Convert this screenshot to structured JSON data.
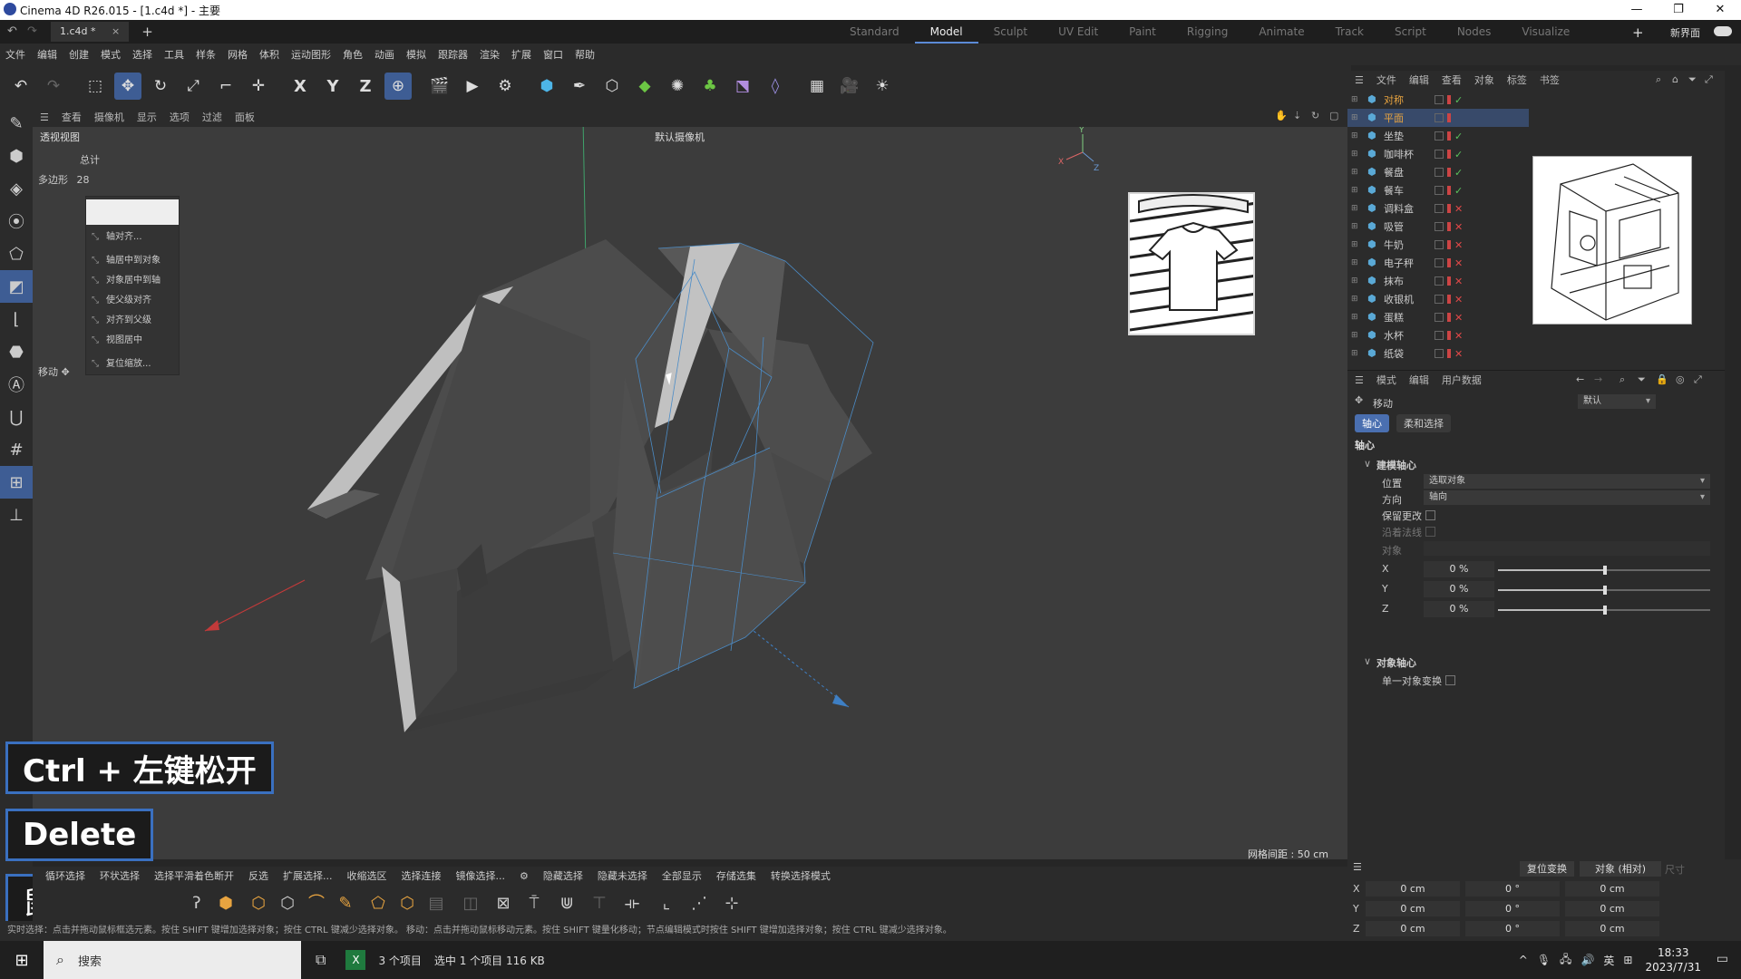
{
  "window": {
    "title": "Cinema 4D R26.015 - [1.c4d *] - 主要",
    "doc_tab": "1.c4d *"
  },
  "layouts": [
    "Standard",
    "Model",
    "Sculpt",
    "UV Edit",
    "Paint",
    "Rigging",
    "Animate",
    "Track",
    "Script",
    "Nodes",
    "Visualize"
  ],
  "active_layout": "Model",
  "new_interface": "新界面",
  "menu": [
    "文件",
    "编辑",
    "创建",
    "模式",
    "选择",
    "工具",
    "样条",
    "网格",
    "体积",
    "运动图形",
    "角色",
    "动画",
    "模拟",
    "跟踪器",
    "渲染",
    "扩展",
    "窗口",
    "帮助"
  ],
  "viewport_menu": [
    "查看",
    "摄像机",
    "显示",
    "选项",
    "过滤",
    "面板"
  ],
  "viewport": {
    "name": "透视视图",
    "camera": "默认摄像机",
    "grid_spacing": "网格间距 : 50 cm",
    "stats_total_label": "总计",
    "stats_poly_label": "多边形",
    "stats_poly_count": "28",
    "move_label": "移动"
  },
  "context_menu": [
    "轴对齐...",
    "轴居中到对象",
    "对象居中到轴",
    "使父级对齐",
    "对齐到父级",
    "视图居中",
    "复位缩放..."
  ],
  "key_overlays": {
    "k1": "Ctrl + 左键松开",
    "k2": "Delete",
    "k3": "鼠标滚动"
  },
  "object_manager": {
    "menu": [
      "文件",
      "编辑",
      "查看",
      "对象",
      "标签",
      "书签"
    ],
    "objects": [
      {
        "name": "对称",
        "state": "ok"
      },
      {
        "name": "平面",
        "state": "none"
      },
      {
        "name": "坐垫",
        "state": "ok"
      },
      {
        "name": "咖啡杯",
        "state": "ok"
      },
      {
        "name": "餐盘",
        "state": "ok"
      },
      {
        "name": "餐车",
        "state": "ok"
      },
      {
        "name": "调料盒",
        "state": "no"
      },
      {
        "name": "吸管",
        "state": "no"
      },
      {
        "name": "牛奶",
        "state": "no"
      },
      {
        "name": "电子秤",
        "state": "no"
      },
      {
        "name": "抹布",
        "state": "no"
      },
      {
        "name": "收银机",
        "state": "no"
      },
      {
        "name": "蛋糕",
        "state": "no"
      },
      {
        "name": "水杯",
        "state": "no"
      },
      {
        "name": "纸袋",
        "state": "no"
      }
    ]
  },
  "attributes": {
    "menu": [
      "模式",
      "编辑",
      "用户数据"
    ],
    "tool": "移动",
    "preset": "默认",
    "tabs": [
      "轴心",
      "柔和选择"
    ],
    "section": "轴心",
    "group1": "建模轴心",
    "position_label": "位置",
    "position_value": "选取对象",
    "orientation_label": "方向",
    "orientation_value": "轴向",
    "keep_changes": "保留更改",
    "along_normal": "沿着法线",
    "object_label": "对象",
    "x_label": "X",
    "x_value": "0 %",
    "y_label": "Y",
    "y_value": "0 %",
    "z_label": "Z",
    "z_value": "0 %",
    "group2": "对象轴心",
    "single_object": "单一对象变换"
  },
  "coords": {
    "reset": "复位变换",
    "mode": "对象 (相对)",
    "size": "尺寸",
    "rows": [
      {
        "axis": "X",
        "pos": "0 cm",
        "rot": "0 °",
        "size": "0 cm"
      },
      {
        "axis": "Y",
        "pos": "0 cm",
        "rot": "0 °",
        "size": "0 cm"
      },
      {
        "axis": "Z",
        "pos": "0 cm",
        "rot": "0 °",
        "size": "0 cm"
      }
    ]
  },
  "bottom_tabs": [
    "循环选择",
    "环状选择",
    "选择平滑着色断开",
    "反选",
    "扩展选择...",
    "收缩选区",
    "选择连接",
    "镜像选择...",
    "隐藏选择",
    "隐藏未选择",
    "全部显示",
    "存储选集",
    "转换选择模式"
  ],
  "status": "实时选择：点击并拖动鼠标框选元素。按住 SHIFT 键增加选择对象；按住 CTRL 键减少选择对象。 移动：点击并拖动鼠标移动元素。按住 SHIFT 键量化移动；节点编辑模式时按住 SHIFT 键增加选择对象；按住 CTRL 键减少选择对象。",
  "taskbar": {
    "search": "搜索",
    "items": "3 个项目",
    "selected": "选中 1 个项目  116 KB",
    "lang": "英",
    "time": "18:33",
    "date": "2023/7/31"
  }
}
